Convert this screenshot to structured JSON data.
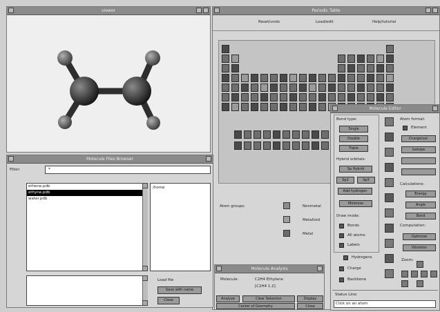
{
  "viewer": {
    "title": "viewer"
  },
  "periodic": {
    "title": "Periodic Table",
    "menu": [
      "Reset/undo",
      "Load/edit",
      "Help/tutorial"
    ],
    "legend": [
      {
        "label": "Nonmetal",
        "color": "#8c8c8c"
      },
      {
        "label": "Metalloid",
        "color": "#9e9e9e"
      },
      {
        "label": "Metal",
        "color": "#6a6a6a"
      }
    ],
    "group_label": "Atom groups:"
  },
  "files": {
    "title": "Molecule Files Browser",
    "filter_label": "Filter:",
    "filter_value": "*",
    "list": [
      "ethene.pdb",
      "ethyne.pdb",
      "water.pdb"
    ],
    "selected_index": 1,
    "side_label": "/home",
    "button1_label": "Load file",
    "button2_label": "Save with name",
    "button3_label": "Close"
  },
  "mol": {
    "title": "Molecule Analysis",
    "label": "Molecule:",
    "value1": "C2H4 Ethylene",
    "value2": "[C2H4 1.2]",
    "btns": [
      "Analyze",
      "Clear Selection",
      "Display"
    ],
    "btn_center": "Center of Geometry",
    "btn_close": "Close"
  },
  "edit": {
    "title": "Molecule Editor",
    "bond_type": "Bond type:",
    "single": "Single",
    "double": "Double",
    "triple": "Triple",
    "hybrid": "Hybrid orbitals:",
    "hyb_btns": [
      "Sp Hybrid",
      "Sp2",
      "Sp3",
      "Add hydrogen",
      "Minimize"
    ],
    "draw_label": "Draw mode:",
    "draw_opts": [
      "Bonds",
      "All atoms",
      "Labels",
      "Hydrogens",
      "Charge",
      "Backbone"
    ],
    "atom_label": "Atom format:",
    "atom_opts": [
      "Element",
      "Charge/val.",
      "Isotope"
    ],
    "calc_label": "Calculations:",
    "calc_btns": [
      "Energy",
      "Angle",
      "Bond"
    ],
    "comp_label": "Computation:",
    "comp_btns": [
      "Optimize",
      "Vibration"
    ],
    "zoom_label": "Zoom:",
    "status_label": "Status Line:",
    "status_value": "Click on an atom"
  }
}
